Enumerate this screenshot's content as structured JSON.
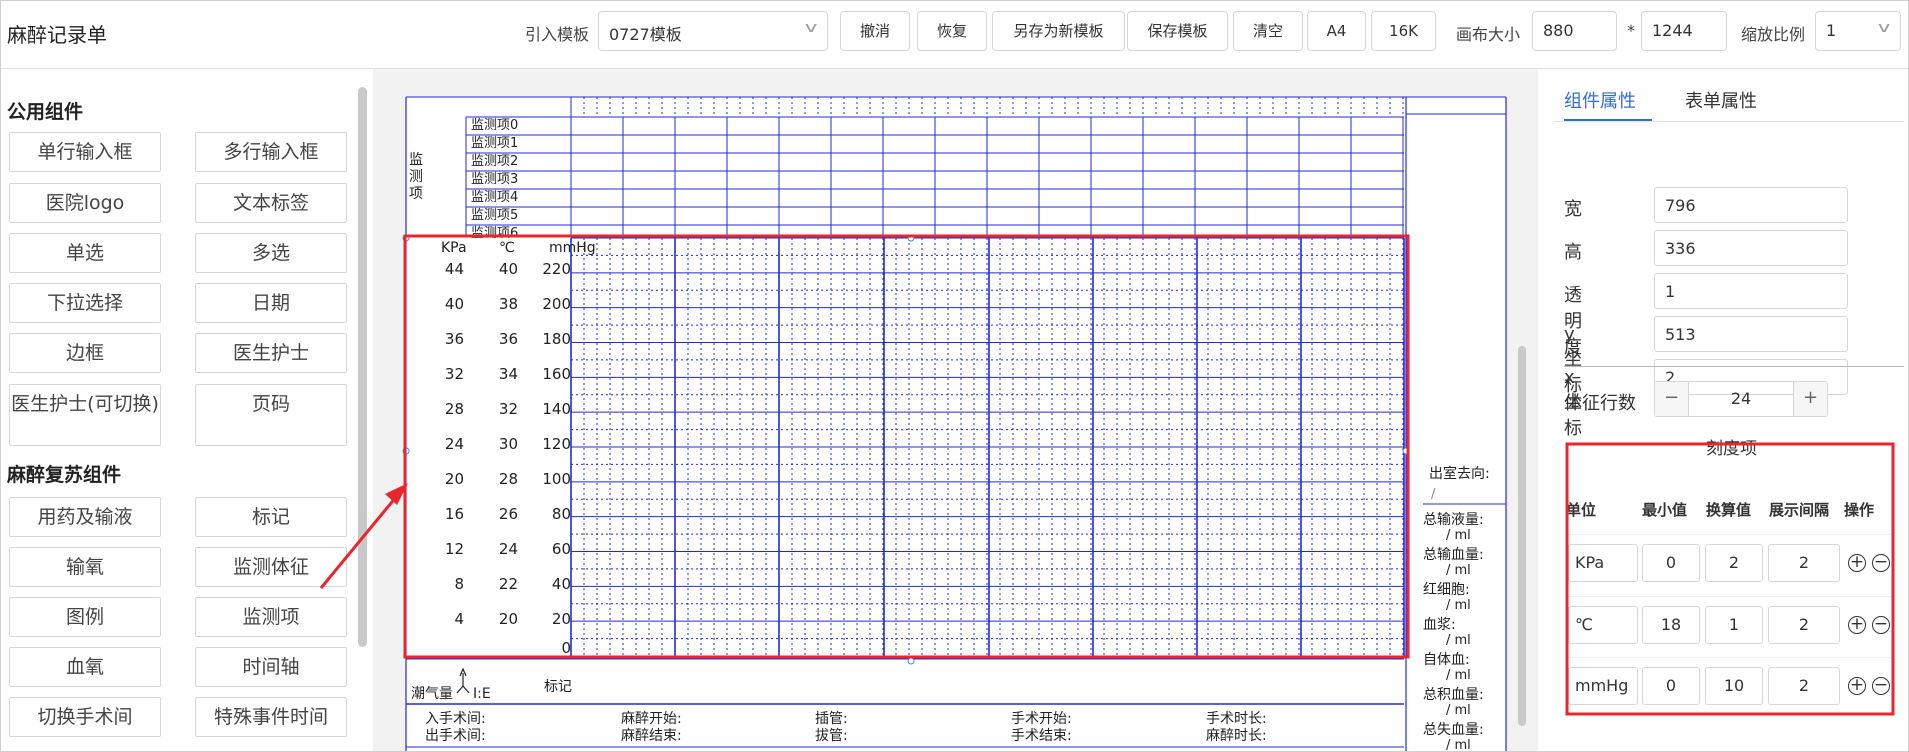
{
  "app_title": "麻醉记录单",
  "toolbar": {
    "template_label": "引入模板",
    "template_value": "0727模板",
    "buttons": [
      "撤消",
      "恢复",
      "另存为新模板",
      "保存模板",
      "清空",
      "A4",
      "16K"
    ],
    "canvas_size_label": "画布大小",
    "canvas_width": "880",
    "times_sign": "*",
    "canvas_height": "1244",
    "zoom_label": "缩放比例",
    "zoom_value": "1"
  },
  "left_panel": {
    "public_title": "公用组件",
    "public_items": [
      "单行输入框",
      "多行输入框",
      "医院logo",
      "文本标签",
      "单选",
      "多选",
      "下拉选择",
      "日期",
      "边框",
      "医生护士",
      "医生护士(可切换)",
      "页码"
    ],
    "anesthesia_title": "麻醉复苏组件",
    "anesthesia_items": [
      "用药及输液",
      "标记",
      "输氧",
      "监测体征",
      "图例",
      "监测项",
      "血氧",
      "时间轴",
      "切换手术间",
      "特殊事件时间"
    ]
  },
  "canvas": {
    "vlabel": "监测项",
    "monitor_items": [
      "监测项0",
      "监测项1",
      "监测项2",
      "监测项3",
      "监测项4",
      "监测项5",
      "监测项6"
    ],
    "col_headers": [
      "KPa",
      "℃",
      "mmHg"
    ],
    "scale_rows": [
      [
        "44",
        "40",
        "220"
      ],
      [
        "40",
        "38",
        "200"
      ],
      [
        "36",
        "36",
        "180"
      ],
      [
        "32",
        "34",
        "160"
      ],
      [
        "28",
        "32",
        "140"
      ],
      [
        "24",
        "30",
        "120"
      ],
      [
        "20",
        "28",
        "100"
      ],
      [
        "16",
        "26",
        "80"
      ],
      [
        "12",
        "24",
        "60"
      ],
      [
        "8",
        "22",
        "40"
      ],
      [
        "4",
        "20",
        "20"
      ],
      [
        "",
        "",
        "0"
      ]
    ],
    "tidal_label": "潮气量",
    "ie_label": "I:E",
    "mark_label": "标记",
    "times": {
      "row1": [
        "入手术间:",
        "麻醉开始:",
        "插管:",
        "手术开始:",
        "手术时长:"
      ],
      "row2": [
        "出手术间:",
        "麻醉结束:",
        "拔管:",
        "手术结束:",
        "麻醉时长:"
      ]
    },
    "side": {
      "exit_label": "出室去向:",
      "exit_value": "/",
      "fields": [
        "总输液量:",
        "总输血量:",
        "红细胞:",
        "血浆:",
        "自体血:",
        "总积血量:",
        "总失血量:"
      ],
      "unit_line": "/ ml"
    }
  },
  "right_panel": {
    "tabs": [
      "组件属性",
      "表单属性"
    ],
    "props": [
      {
        "label": "宽",
        "value": "796"
      },
      {
        "label": "高",
        "value": "336"
      },
      {
        "label": "透明度",
        "value": "1"
      },
      {
        "label": "y 坐标",
        "value": "513"
      },
      {
        "label": "x 坐标",
        "value": "2"
      }
    ],
    "vital_rows_label": "体征行数",
    "vital_rows_value": "24",
    "minus": "−",
    "plus": "+",
    "scale_section": {
      "title": "刻度项",
      "headers": [
        "单位",
        "最小值",
        "换算值",
        "展示间隔",
        "操作"
      ],
      "rows": [
        {
          "unit": "KPa",
          "min": "0",
          "conv": "2",
          "interval": "2"
        },
        {
          "unit": "℃",
          "min": "18",
          "conv": "1",
          "interval": "2"
        },
        {
          "unit": "mmHg",
          "min": "0",
          "conv": "10",
          "interval": "2"
        }
      ],
      "add_icon": "+",
      "remove_icon": "−"
    }
  },
  "colors": {
    "accent": "#2f6fdb",
    "grid": "#1f2bd6",
    "highlight": "#e8262b"
  }
}
